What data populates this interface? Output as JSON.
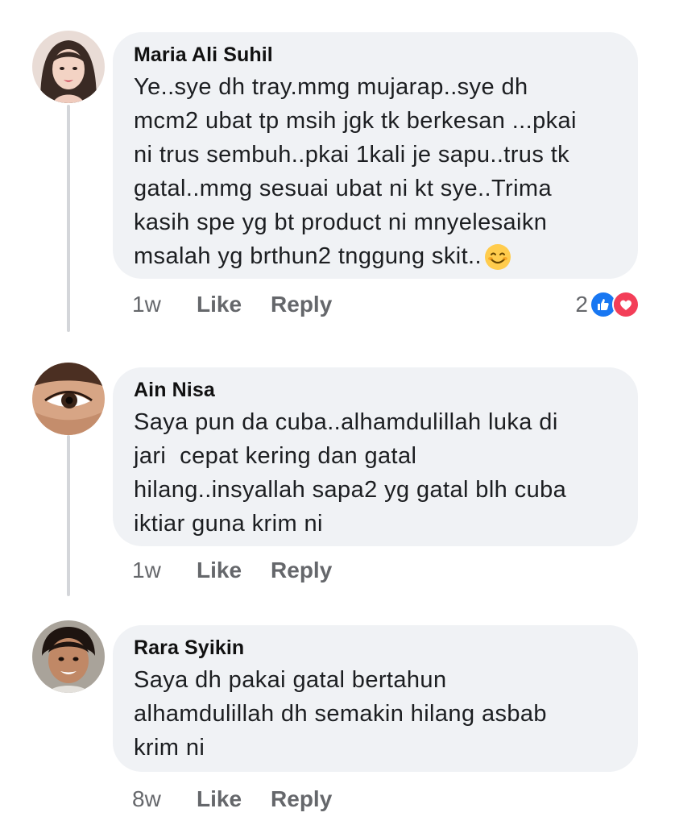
{
  "comments": [
    {
      "author": "Maria Ali Suhil",
      "lines": [
        "Ye..sye dh tray.mmg mujarap..sye dh",
        "mcm2 ubat tp msih jgk tk berkesan ...pkai",
        "ni trus sembuh..pkai 1kali je sapu..trus tk",
        "gatal..mmg sesuai ubat ni kt sye..Trima",
        "kasih spe yg bt product ni mnyelesaikn",
        "msalah yg brthun2 tnggung skit.."
      ],
      "time": "1w",
      "like_label": "Like",
      "reply_label": "Reply",
      "reaction_count": "2",
      "reaction_icons": [
        "like-reaction-icon",
        "love-reaction-icon"
      ],
      "emoji": "smiling-face-emoji"
    },
    {
      "author": "Ain Nisa",
      "lines": [
        "Saya pun da cuba..alhamdulillah luka di",
        "jari  cepat kering dan gatal",
        "hilang..insyallah sapa2 yg gatal blh cuba",
        "iktiar guna krim ni"
      ],
      "time": "1w",
      "like_label": "Like",
      "reply_label": "Reply"
    },
    {
      "author": "Rara Syikin",
      "lines": [
        "Saya dh pakai gatal bertahun",
        "alhamdulillah dh semakin hilang asbab",
        "krim ni"
      ],
      "time": "8w",
      "like_label": "Like",
      "reply_label": "Reply"
    }
  ],
  "colors": {
    "bubble": "#f0f2f5",
    "meta_text": "#65676b",
    "like_blue": "#1877f2",
    "love_red": "#f33e58"
  }
}
